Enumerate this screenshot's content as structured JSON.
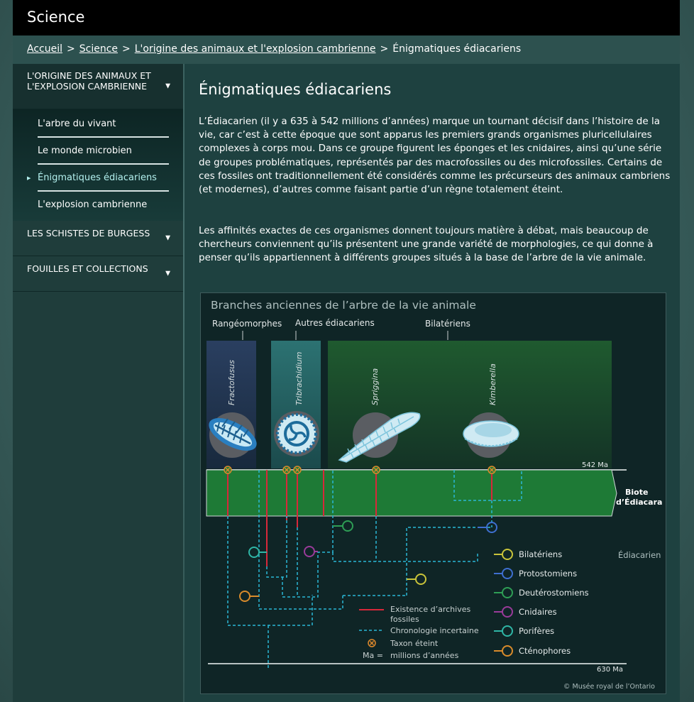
{
  "header": {
    "title": "Science"
  },
  "breadcrumb": {
    "items": [
      "Accueil",
      "Science",
      "L'origine des animaux et l'explosion cambrienne"
    ],
    "current": "Énigmatiques édiacariens",
    "separator": ">"
  },
  "sidebar": {
    "section1": {
      "label": "L'ORIGINE DES ANIMAUX ET L'EXPLOSION CAMBRIENNE"
    },
    "subitems": [
      {
        "label": "L'arbre du vivant"
      },
      {
        "label": "Le monde microbien"
      },
      {
        "label": "Énigmatiques édiacariens"
      },
      {
        "label": "L'explosion cambrienne"
      }
    ],
    "section2": {
      "label": "LES SCHISTES DE BURGESS"
    },
    "section3": {
      "label": "FOUILLES ET COLLECTIONS"
    },
    "caret": "▼",
    "bullet": "▶"
  },
  "main": {
    "title": "Énigmatiques édiacariens",
    "p1": "L’Édiacarien (il y a 635 à 542 millions d’années) marque un tournant décisif dans l’histoire de la vie, car c’est à cette époque que sont apparus les premiers grands organismes pluricellulaires complexes à corps mou. Dans ce groupe figurent les éponges et les cnidaires, ainsi qu’une série de groupes problématiques, représentés par des macrofossiles ou des microfossiles. Certains de ces fossiles ont traditionnellement été considérés comme les précurseurs des animaux cambriens (et modernes), d’autres comme faisant partie d’un règne totalement éteint.",
    "p2": "Les affinités exactes de ces organismes donnent toujours matière à débat, mais beaucoup de chercheurs conviennent qu’ils présentent une grande variété de morphologies, ce qui donne à penser qu’ils appartiennent à différents groupes situés à la base de l’arbre de la vie animale."
  },
  "figure": {
    "title": "Branches anciennes de l’arbre de la vie animale",
    "groups": [
      "Rangéomorphes",
      "Autres édiacariens",
      "Bilatériens"
    ],
    "genera": [
      "Fractofusus",
      "Tribrachidium",
      "Spriggina",
      "Kimberella"
    ],
    "top_time": "542 Ma",
    "bottom_time": "630 Ma",
    "biota_label_1": "Biote",
    "biota_label_2": "d’Édiacara",
    "period": "Édiacarien",
    "legend": [
      {
        "label": "Bilatériens",
        "color": "#c9c43a"
      },
      {
        "label": "Protostomiens",
        "color": "#3e6fd0"
      },
      {
        "label": "Deutérostomiens",
        "color": "#2e9e55"
      },
      {
        "label": "Cnidaires",
        "color": "#9a3b9a"
      },
      {
        "label": "Porifères",
        "color": "#2fb6a6"
      },
      {
        "label": "Cténophores",
        "color": "#d98b2b"
      }
    ],
    "key": {
      "fossil_line_1": "Existence d’archives",
      "fossil_line_2": "fossiles",
      "uncertain": "Chronologie incertaine",
      "extinct": "Taxon éteint",
      "ma_1": "Ma =",
      "ma_2": "millions d’années"
    },
    "credit": "© Musée royal de l’Ontario",
    "colors": {
      "fossil": "#d8283a",
      "uncertain": "#2ab8d6",
      "extinct": "#e08a2c",
      "band": "#1e7a36"
    }
  }
}
